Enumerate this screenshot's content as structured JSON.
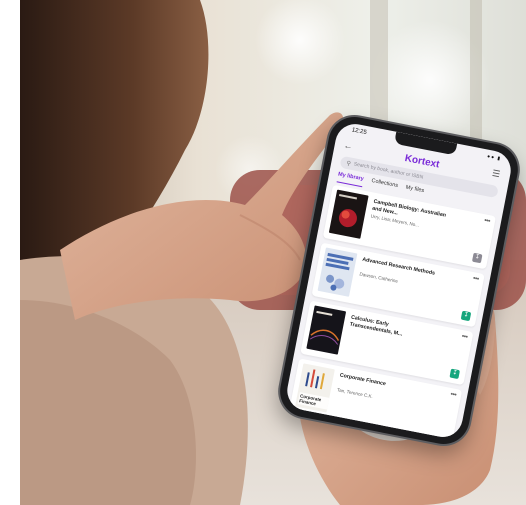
{
  "status": {
    "time": "12:25"
  },
  "app": {
    "title": "Kortext"
  },
  "search": {
    "placeholder": "Search by book, author or ISBN"
  },
  "tabs": [
    {
      "label": "My library",
      "active": true
    },
    {
      "label": "Collections",
      "active": false
    },
    {
      "label": "My files",
      "active": false
    }
  ],
  "books": [
    {
      "title": "Campbell Biology: Australian and New...",
      "author": "Urry, Lisa; Meyers, No...",
      "download_state": "downloaded",
      "cover_color": "#1a1414",
      "cover_accent": "#b21d2b"
    },
    {
      "title": "Advanced Research Methods",
      "author": "Dawson, Catherine",
      "download_state": "available",
      "cover_color": "#dfe6f1",
      "cover_accent": "#4c6fb5"
    },
    {
      "title": "Calculus: Early Transcendentals, M...",
      "author": "",
      "download_state": "available",
      "cover_color": "#15141a",
      "cover_accent": "#d8722b"
    },
    {
      "title": "Corporate Finance",
      "author": "Tan, Terence C.K.",
      "download_state": "",
      "cover_color": "#f3f1ec",
      "cover_accent": "#2d4a8d",
      "cover_text": "Corporate Finance"
    }
  ],
  "colors": {
    "accent": "#7a2bd8",
    "download": "#16a67d"
  },
  "icons": [
    "back-arrow-icon",
    "menu-icon",
    "search-icon",
    "more-icon",
    "download-icon"
  ]
}
